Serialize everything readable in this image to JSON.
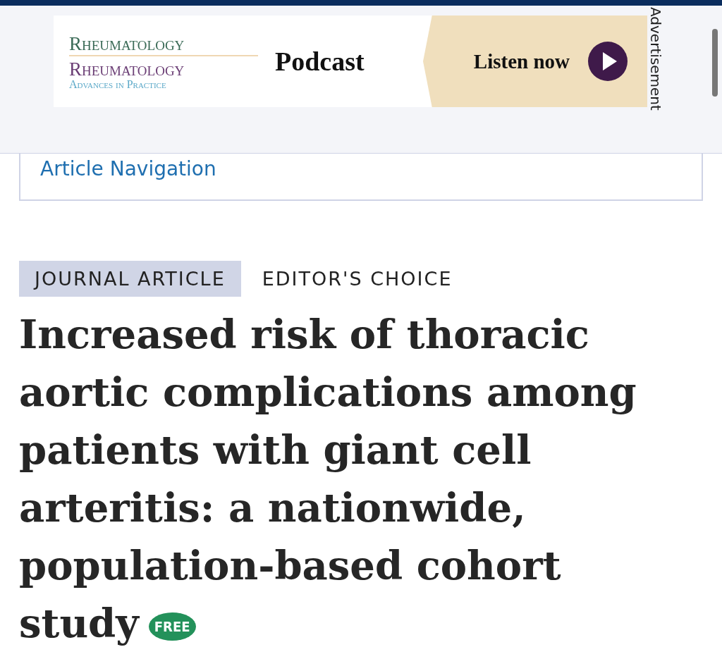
{
  "advertisement": {
    "brand_primary": "Rheumatology",
    "brand_secondary": "Rheumatology",
    "brand_tagline": "Advances in Practice",
    "title": "Podcast",
    "cta": "Listen now",
    "label": "Advertisement"
  },
  "article_navigation": {
    "label": "Article Navigation"
  },
  "tags": [
    {
      "label": "JOURNAL ARTICLE",
      "kind": "filled"
    },
    {
      "label": "EDITOR'S CHOICE",
      "kind": "plain"
    }
  ],
  "article": {
    "title": "Increased risk of thoracic aortic complications among patients with giant cell arteritis: a nationwide, population-based cohort study",
    "access_badge": "FREE"
  }
}
